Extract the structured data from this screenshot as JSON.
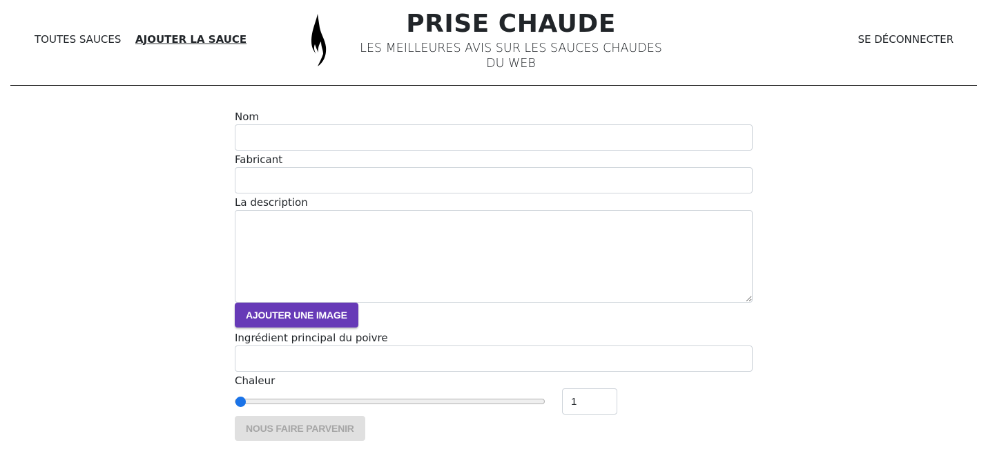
{
  "nav": {
    "all_sauces": "TOUTES SAUCES",
    "add_sauce": "AJOUTER LA SAUCE",
    "logout": "SE DÉCONNECTER"
  },
  "brand": {
    "logo_icon": "flame-icon",
    "title": "PRISE CHAUDE",
    "subtitle": "LES MEILLEURES AVIS SUR LES SAUCES CHAUDES DU WEB"
  },
  "form": {
    "name_label": "Nom",
    "name_value": "",
    "manufacturer_label": "Fabricant",
    "manufacturer_value": "",
    "description_label": "La description",
    "description_value": "",
    "add_image_button": "AJOUTER UNE IMAGE",
    "main_pepper_label": "Ingrédient principal du poivre",
    "main_pepper_value": "",
    "heat_label": "Chaleur",
    "heat_value": "1",
    "heat_slider_level": 1,
    "submit_button": "NOUS FAIRE PARVENIR"
  },
  "colors": {
    "accent": "#673ab7",
    "slider": "#1a73e8",
    "disabled_bg": "#e0e0e0",
    "disabled_text": "#a6a6a6"
  }
}
